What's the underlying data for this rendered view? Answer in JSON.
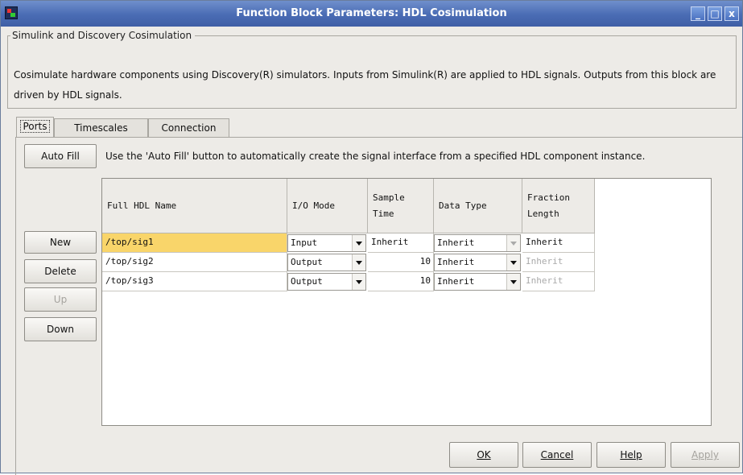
{
  "window": {
    "title": "Function Block Parameters: HDL Cosimulation",
    "controls": {
      "minimize": "_",
      "maximize": "□",
      "close": "x"
    }
  },
  "group": {
    "legend": "Simulink and Discovery Cosimulation",
    "description": "Cosimulate hardware components using Discovery(R) simulators. Inputs from Simulink(R) are applied to HDL signals. Outputs from this block are driven by HDL signals."
  },
  "tabs": [
    {
      "label": "Ports",
      "active": true
    },
    {
      "label": "Timescales",
      "active": false
    },
    {
      "label": "Connection",
      "active": false
    }
  ],
  "ports": {
    "auto_fill_label": "Auto Fill",
    "hint": "Use the 'Auto Fill' button to automatically create the signal interface from a specified HDL component instance.",
    "side_buttons": [
      {
        "label": "New",
        "enabled": true
      },
      {
        "label": "Delete",
        "enabled": true
      },
      {
        "label": "Up",
        "enabled": false
      },
      {
        "label": "Down",
        "enabled": true
      }
    ],
    "columns": [
      "Full HDL Name",
      "I/O Mode",
      "Sample Time",
      "Data Type",
      "Fraction Length"
    ],
    "columns_split": [
      [
        "Full HDL Name"
      ],
      [
        "I/O Mode"
      ],
      [
        "Sample",
        "Time"
      ],
      [
        "Data Type"
      ],
      [
        "Fraction",
        "Length"
      ]
    ],
    "rows": [
      {
        "name": "/top/sig1",
        "io_mode": "Input",
        "sample_time": "Inherit",
        "data_type": "Inherit",
        "fraction_length": "Inherit",
        "selected": true
      },
      {
        "name": "/top/sig2",
        "io_mode": "Output",
        "sample_time": "10",
        "data_type": "Inherit",
        "fraction_length": "Inherit",
        "selected": false
      },
      {
        "name": "/top/sig3",
        "io_mode": "Output",
        "sample_time": "10",
        "data_type": "Inherit",
        "fraction_length": "Inherit",
        "selected": false
      }
    ]
  },
  "footer": {
    "ok": "OK",
    "cancel": "Cancel",
    "help": "Help",
    "apply": "Apply"
  },
  "colors": {
    "titlebar": "#4a6cb4",
    "selected_cell": "#f9d56a",
    "window_bg": "#edebe7"
  }
}
